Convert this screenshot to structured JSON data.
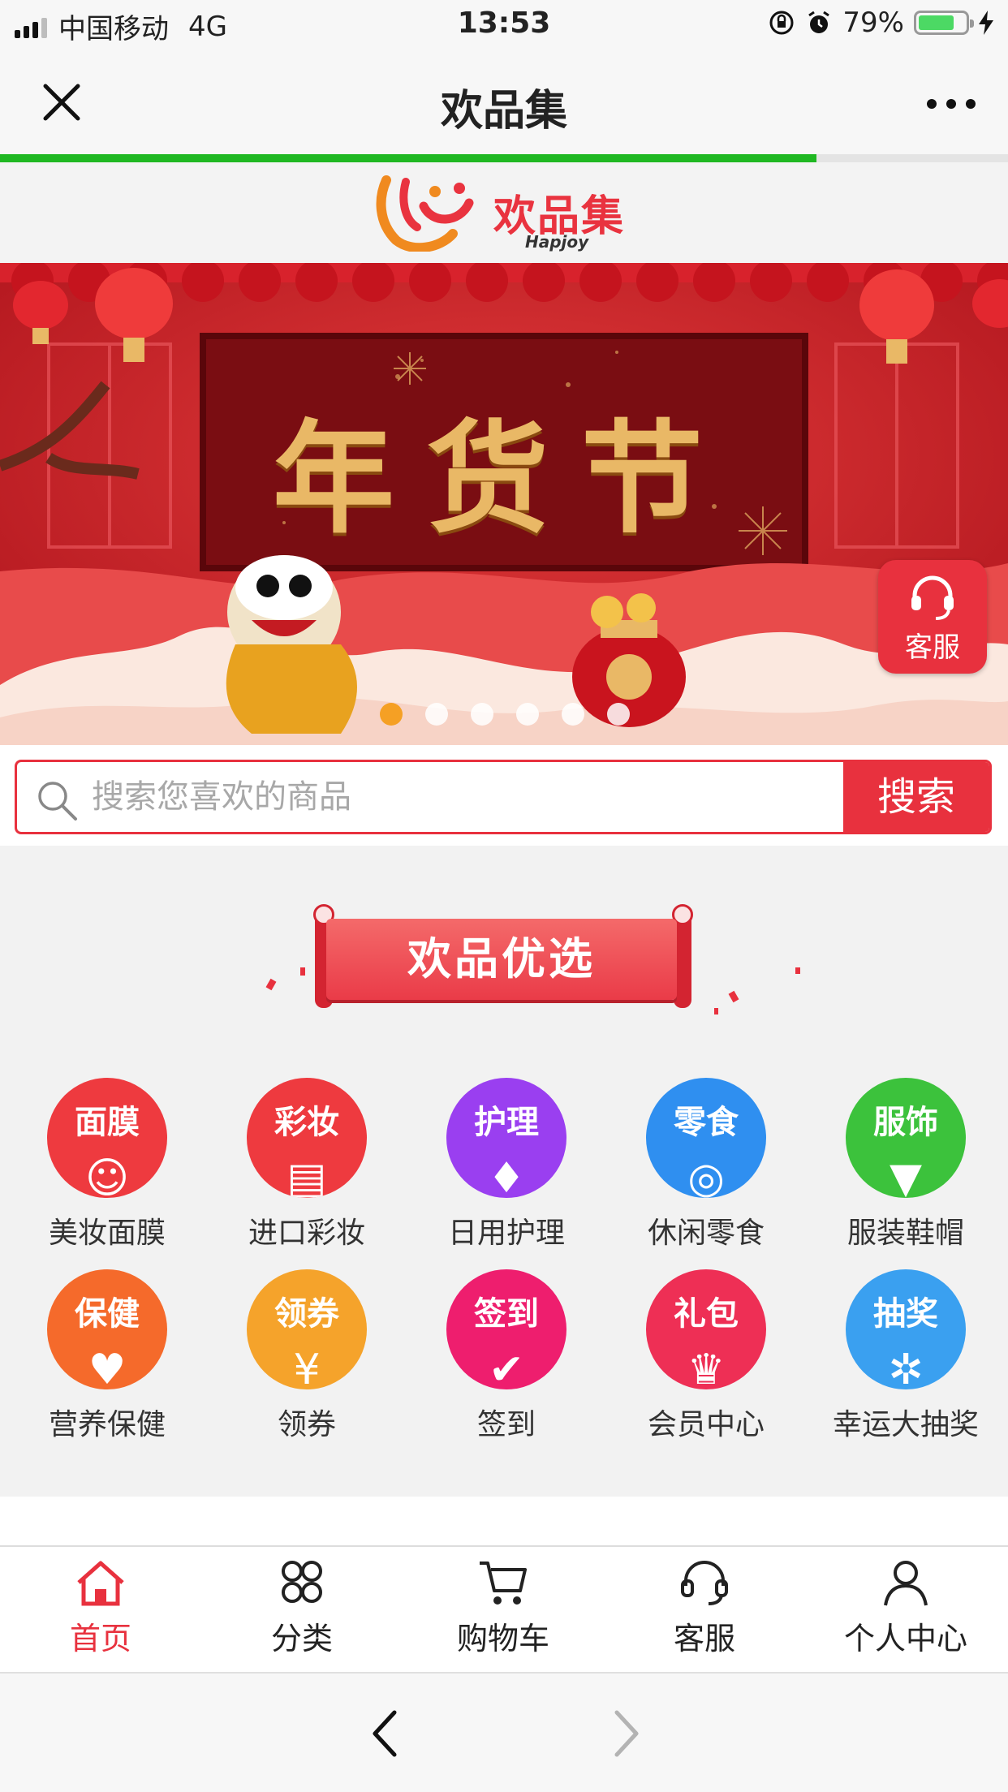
{
  "status_bar": {
    "carrier": "中国移动",
    "network": "4G",
    "time": "13:53",
    "battery_percent": "79%",
    "battery_level": 0.79
  },
  "nav": {
    "title": "欢品集",
    "close_icon": "close-icon",
    "more_icon": "more-icon",
    "load_progress": 0.81,
    "progress_color": "#1fb822"
  },
  "logo": {
    "cn": "欢品集",
    "en": "Hapjoy"
  },
  "banner": {
    "headline": "年货节",
    "slide_count": 6,
    "active_slide": 0,
    "customer_service_label": "客服"
  },
  "search": {
    "placeholder": "搜索您喜欢的商品",
    "button_label": "搜索"
  },
  "section": {
    "title": "欢品优选"
  },
  "categories": [
    {
      "badge": "面膜",
      "label": "美妆面膜",
      "color": "#ee3a3f",
      "icon": "mask-icon"
    },
    {
      "badge": "彩妆",
      "label": "进口彩妆",
      "color": "#ee3a3f",
      "icon": "lipstick-icon"
    },
    {
      "badge": "护理",
      "label": "日用护理",
      "color": "#9a3ff0",
      "icon": "lotion-icon"
    },
    {
      "badge": "零食",
      "label": "休闲零食",
      "color": "#2f8ff0",
      "icon": "snack-icon"
    },
    {
      "badge": "服饰",
      "label": "服装鞋帽",
      "color": "#3cc23c",
      "icon": "shirt-icon"
    },
    {
      "badge": "保健",
      "label": "营养保健",
      "color": "#f56a2b",
      "icon": "health-icon"
    },
    {
      "badge": "领券",
      "label": "领券",
      "color": "#f5a32b",
      "icon": "coupon-icon"
    },
    {
      "badge": "签到",
      "label": "签到",
      "color": "#ee1e6e",
      "icon": "checkin-icon"
    },
    {
      "badge": "礼包",
      "label": "会员中心",
      "color": "#ee2f55",
      "icon": "crown-icon"
    },
    {
      "badge": "抽奖",
      "label": "幸运大抽奖",
      "color": "#3aa0f0",
      "icon": "wheel-icon"
    }
  ],
  "tabbar": {
    "items": [
      {
        "label": "首页",
        "icon": "home-icon",
        "active": true
      },
      {
        "label": "分类",
        "icon": "category-icon",
        "active": false
      },
      {
        "label": "购物车",
        "icon": "cart-icon",
        "active": false
      },
      {
        "label": "客服",
        "icon": "headset-icon",
        "active": false
      },
      {
        "label": "个人中心",
        "icon": "user-icon",
        "active": false
      }
    ],
    "active_color": "#e8313e"
  },
  "browser_bar": {
    "back_icon": "chevron-left-icon",
    "forward_icon": "chevron-right-icon"
  }
}
